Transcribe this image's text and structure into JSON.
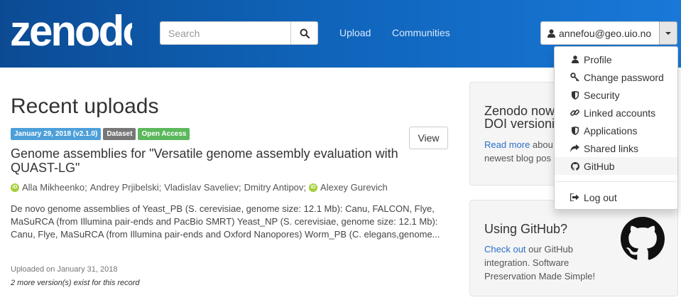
{
  "header": {
    "logo_text": "zenodo",
    "search": {
      "placeholder": "Search",
      "value": ""
    },
    "nav": [
      {
        "label": "Upload"
      },
      {
        "label": "Communities"
      }
    ],
    "user": {
      "email": "annefou@geo.uio.no"
    }
  },
  "main": {
    "title": "Recent uploads",
    "record": {
      "date_label": "January 29, 2018 (v2.1.0)",
      "type_label": "Dataset",
      "access_label": "Open Access",
      "view_label": "View",
      "title": "Genome assemblies for \"Versatile genome assembly evaluation with QUAST-LG\"",
      "authors": [
        "Alla Mikheenko;",
        "Andrey Prjibelski;",
        "Vladislav Saveliev;",
        "Dmitry Antipov;",
        "Alexey Gurevich"
      ],
      "description": "De novo genome assemblies of Yeast_PB (S. cerevisiae, genome size: 12.1 Mb): Canu, FALCON, Flye, MaSuRCA (from Illumina pair-ends and PacBio SMRT) Yeast_NP (S. cerevisiae, genome size: 12.1 Mb): Canu, Flye, MaSuRCA (from Illumina pair-ends and Oxford Nanopores) Worm_PB (C. elegans,genome...",
      "uploaded": "Uploaded on January 31, 2018",
      "versions": "2 more version(s) exist for this record"
    }
  },
  "sidebar": {
    "panel1": {
      "title_line1": "Zenodo now",
      "title_line2": "DOI versionin",
      "link": "Read more",
      "text_line1_rest": " abou",
      "text_line2": "newest blog pos"
    },
    "panel2": {
      "title": "Using GitHub?",
      "link": "Check out",
      "text_line1_rest": " our GitHub",
      "text_line2": "integration. Software",
      "text_line3": "Preservation Made Simple!"
    }
  },
  "dropdown": {
    "items": [
      {
        "label": "Profile",
        "icon": "user-icon"
      },
      {
        "label": "Change password",
        "icon": "key-icon"
      },
      {
        "label": "Security",
        "icon": "shield-icon"
      },
      {
        "label": "Linked accounts",
        "icon": "link-icon"
      },
      {
        "label": "Applications",
        "icon": "shield-icon"
      },
      {
        "label": "Shared links",
        "icon": "share-icon"
      },
      {
        "label": "GitHub",
        "icon": "github-icon"
      }
    ],
    "logout": {
      "label": "Log out",
      "icon": "sign-out-icon"
    }
  },
  "colors": {
    "header_start": "#0c4b94",
    "header_end": "#1978d8",
    "label_date": "#4d9fd9",
    "label_type": "#777777",
    "label_access": "#5cb85c",
    "link": "#2a6fc9"
  }
}
